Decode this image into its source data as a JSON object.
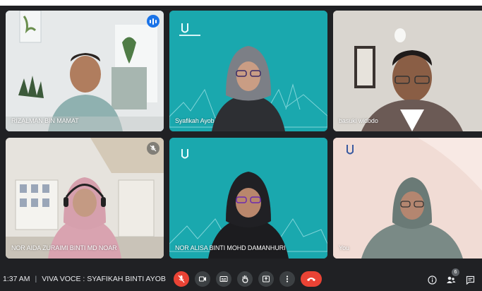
{
  "participants": [
    {
      "name": "RIZALMAN BIN MAMAT",
      "state": "speaking"
    },
    {
      "name": "Syafikah Ayob",
      "state": ""
    },
    {
      "name": "basuki widodo",
      "state": ""
    },
    {
      "name": "NOR AIDA ZURAIMI BINTI MD NOAR",
      "state": "muted"
    },
    {
      "name": "NOR ALISA BINTI MOHD DAMANHURI",
      "state": ""
    },
    {
      "name": "You",
      "state": ""
    }
  ],
  "meeting": {
    "time": "1:37 AM",
    "title": "VIVA VOCE : SYAFIKAH BINTI AYOB",
    "participant_count": "6"
  },
  "colors": {
    "accent": "#1a73e8",
    "danger": "#ea4335",
    "teal_background": "#1aa8ae",
    "control_bar": "#202124"
  }
}
